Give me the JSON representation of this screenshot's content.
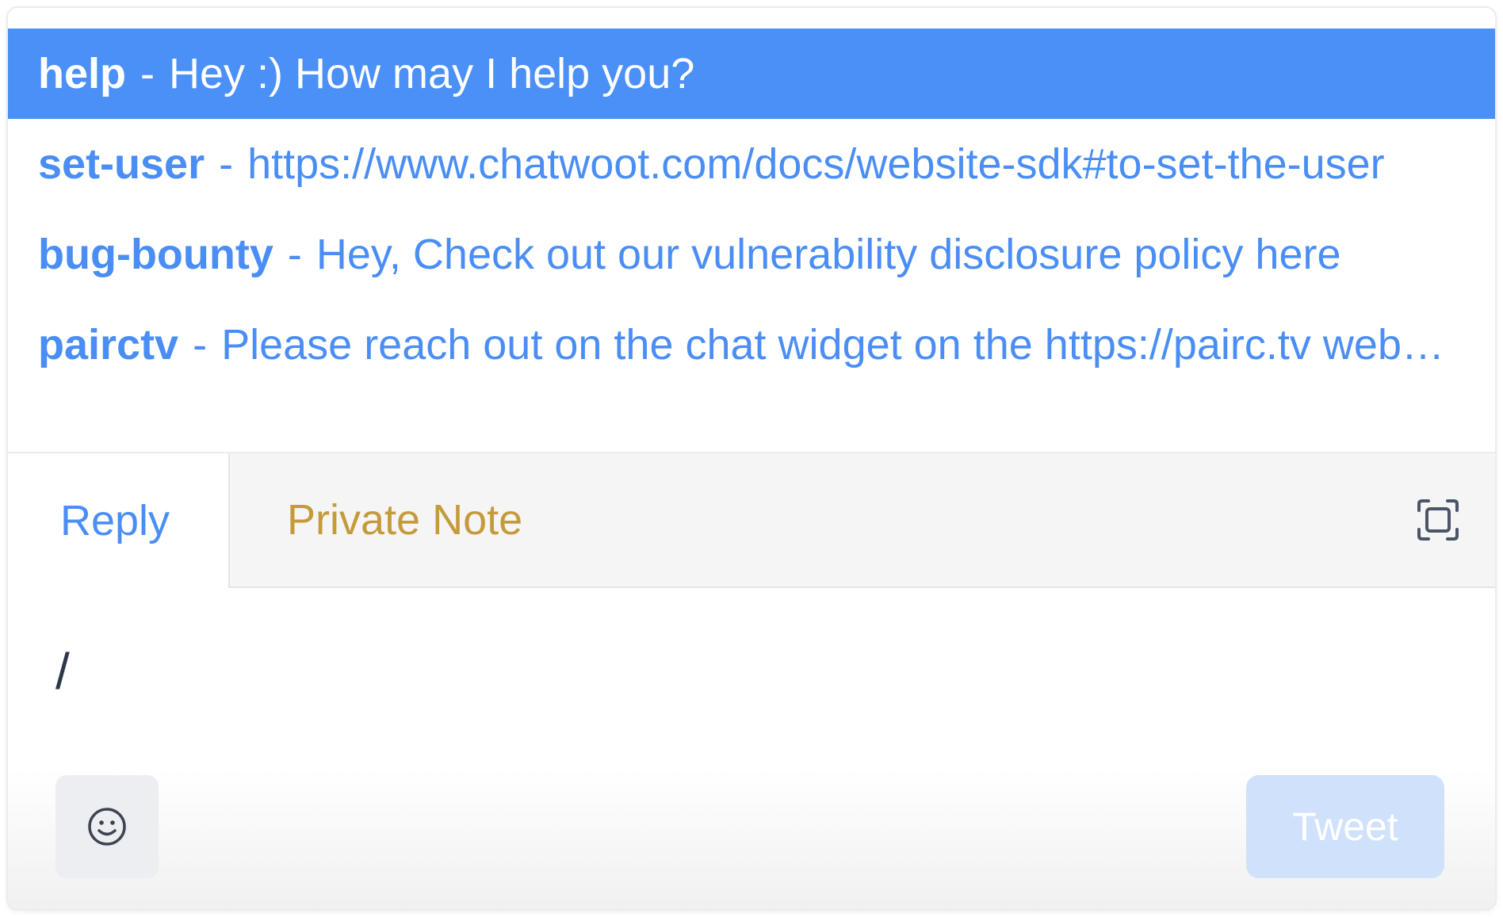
{
  "colors": {
    "accent": "#4a90f7",
    "link_text": "#4a8ef5",
    "private_note": "#c59a3a",
    "tweet_button_bg": "#cfe1fb"
  },
  "suggestions": [
    {
      "short_code": "help",
      "separator": "-",
      "content": "Hey :) How may I help you?",
      "active": true
    },
    {
      "short_code": "set-user",
      "separator": "-",
      "content": "https://www.chatwoot.com/docs/website-sdk#to-set-the-user",
      "active": false
    },
    {
      "short_code": "bug-bounty",
      "separator": "-",
      "content": "Hey, Check out our vulnerability disclosure policy here",
      "active": false
    },
    {
      "short_code": "pairctv",
      "separator": "-",
      "content": "Please reach out on the chat widget on the https://pairc.tv website",
      "active": false
    }
  ],
  "tabs": {
    "reply": "Reply",
    "private_note": "Private Note"
  },
  "icons": {
    "expand": "expand-icon",
    "emoji": "smiley-icon"
  },
  "editor": {
    "value": "/"
  },
  "actions": {
    "send_label": "Tweet"
  }
}
